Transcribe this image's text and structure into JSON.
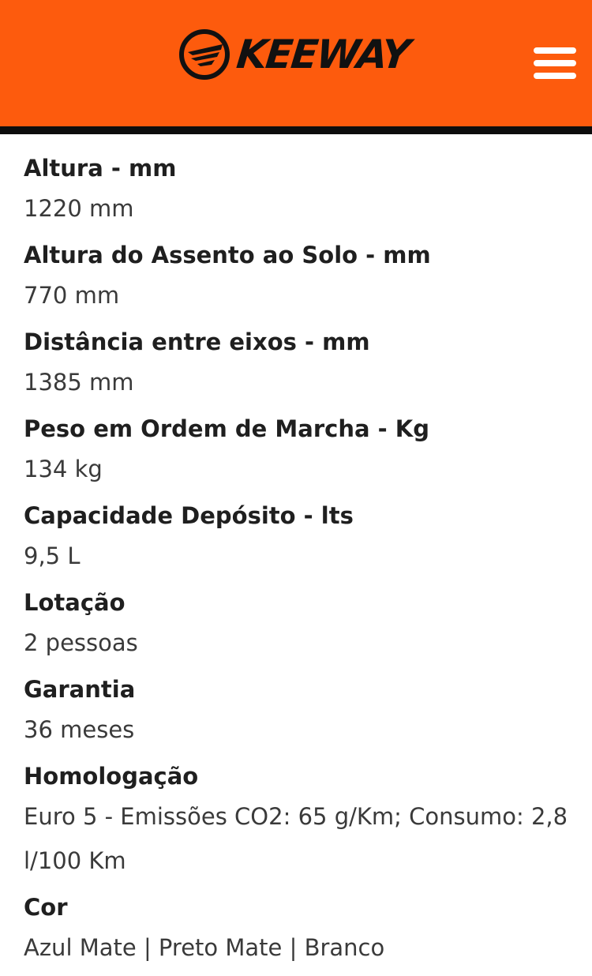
{
  "header": {
    "brand": "KEEWAY",
    "logo_icon": "keeway-emblem-icon",
    "menu_icon": "hamburger-menu-icon",
    "background_color": "#fd5b0d",
    "border_color": "#0d0d0d"
  },
  "specs": [
    {
      "label": "Altura - mm",
      "value": "1220 mm"
    },
    {
      "label": "Altura do Assento ao Solo - mm",
      "value": "770 mm"
    },
    {
      "label": "Distância entre eixos - mm",
      "value": "1385 mm"
    },
    {
      "label": "Peso em Ordem de Marcha - Kg",
      "value": "134 kg"
    },
    {
      "label": "Capacidade Depósito - lts",
      "value": "9,5 L"
    },
    {
      "label": "Lotação",
      "value": "2 pessoas"
    },
    {
      "label": "Garantia",
      "value": "36 meses"
    },
    {
      "label": "Homologação",
      "value": "Euro 5 - Emissões CO2: 65 g/Km; Consumo: 2,8 l/100 Km"
    },
    {
      "label": "Cor",
      "value": "Azul Mate | Preto Mate | Branco"
    }
  ]
}
